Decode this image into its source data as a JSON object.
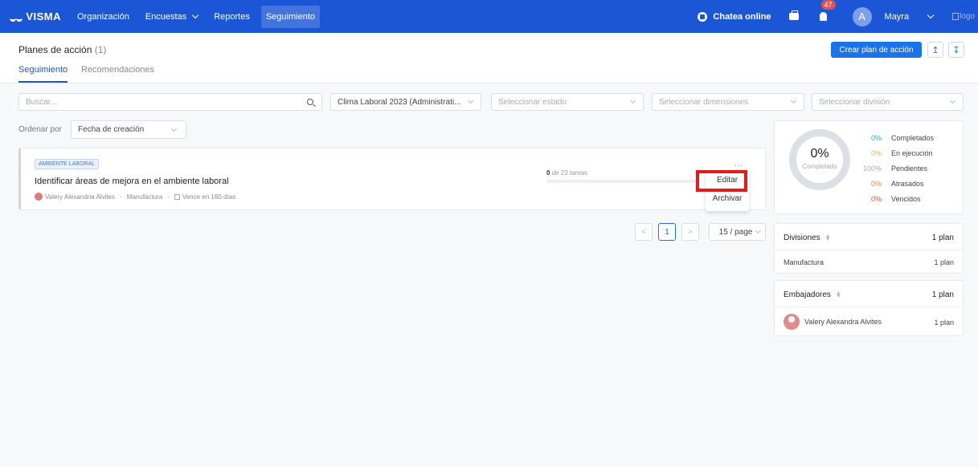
{
  "nav": {
    "brand": "VISMA",
    "items": [
      "Organización",
      "Encuestas",
      "Reportes",
      "Seguimiento"
    ],
    "chat_label": "Chatea online",
    "notif_count": "47",
    "avatar_letter": "A",
    "username": "Mayra",
    "logo_alt": "logo"
  },
  "header": {
    "title": "Planes de acción",
    "count": "(1)",
    "tabs": [
      "Seguimiento",
      "Recomendaciones"
    ],
    "create_button": "Crear plan de acción"
  },
  "filters": {
    "search_placeholder": "Buscar...",
    "survey": "Clima Laboral 2023 (Administrati...",
    "estado": "Seleccionar estado",
    "dimensiones": "Seleccionar dimensiones",
    "division": "Seleccionar división"
  },
  "sort": {
    "label": "Ordenar por",
    "value": "Fecha de creación"
  },
  "plan": {
    "tag": "AMBIENTE LABORAL",
    "title": "Identificar áreas de mejora en el ambiente laboral",
    "owner": "Valery Alexandria Alvites",
    "division": "Manufactura",
    "due": "Vence en 160 días",
    "done_tasks": "0",
    "tasks_suffix": "de 23 tareas",
    "more": "...",
    "menu": [
      "Editar",
      "Archivar"
    ]
  },
  "pagination": {
    "current": "1",
    "page_size": "15 / page",
    "prev": "<",
    "next": ">"
  },
  "summary": {
    "percent": "0%",
    "percent_label": "Completado",
    "legend": [
      {
        "value": "0%",
        "label": "Completados",
        "color": "#2bb3a3"
      },
      {
        "value": "0%",
        "label": "En ejecución",
        "color": "#f0b44a"
      },
      {
        "value": "100%",
        "label": "Pendientes",
        "color": "#aaaaaa"
      },
      {
        "value": "0%",
        "label": "Atrasados",
        "color": "#e8833a"
      },
      {
        "value": "0%",
        "label": "Vencidos",
        "color": "#e05252"
      }
    ]
  },
  "divisions": {
    "title": "Divisiones",
    "total": "1 plan",
    "rows": [
      {
        "name": "Manufactura",
        "value": "1 plan"
      }
    ]
  },
  "ambassadors": {
    "title": "Embajadores",
    "total": "1 plan",
    "rows": [
      {
        "name": "Valery Alexandra Alvites",
        "value": "1 plan"
      }
    ]
  }
}
